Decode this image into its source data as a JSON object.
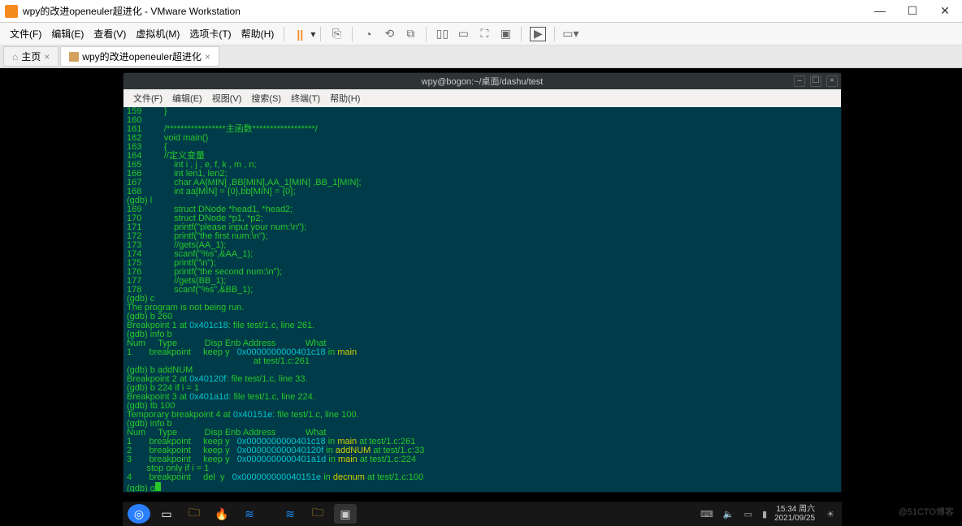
{
  "window": {
    "title": "wpy的改进openeuler超进化 - VMware Workstation"
  },
  "menu": {
    "file": "文件(F)",
    "edit": "编辑(E)",
    "view": "查看(V)",
    "vm": "虚拟机(M)",
    "tabs": "选项卡(T)",
    "help": "帮助(H)"
  },
  "tabs": {
    "home": "主页",
    "vm": "wpy的改进openeuler超进化"
  },
  "guest": {
    "title": "wpy@bogon:~/桌面/dashu/test",
    "menu": {
      "file": "文件(F)",
      "edit": "编辑(E)",
      "view": "视图(V)",
      "search": "搜索(S)",
      "terminal": "终端(T)",
      "help": "帮助(H)"
    }
  },
  "terminal": [
    {
      "lineno": "159",
      "body": "    }"
    },
    {
      "lineno": "160",
      "body": ""
    },
    {
      "lineno": "161",
      "body": "    /*****************主函数******************/"
    },
    {
      "lineno": "162",
      "body": "    void main()"
    },
    {
      "lineno": "163",
      "body": "    {"
    },
    {
      "lineno": "164",
      "body": "    //定义变量"
    },
    {
      "lineno": "165",
      "body": "        int i , j , e, f, k , m , n;"
    },
    {
      "lineno": "166",
      "body": "        int len1, len2;"
    },
    {
      "lineno": "167",
      "body": "        char AA[MIN] ,BB[MIN],AA_1[MIN] ,BB_1[MIN];"
    },
    {
      "lineno": "168",
      "body": "        int aa[MIN] = {0},bb[MIN] = {0};"
    },
    {
      "gdb": "(gdb) l"
    },
    {
      "lineno": "169",
      "body": "        struct DNode *head1, *head2;"
    },
    {
      "lineno": "170",
      "body": "        struct DNode *p1, *p2;"
    },
    {
      "lineno": "171",
      "body": "        printf(\"please input your num:\\n\");"
    },
    {
      "lineno": "172",
      "body": "        printf(\"the first num:\\n\");"
    },
    {
      "lineno": "173",
      "body": "        //gets(AA_1);"
    },
    {
      "lineno": "174",
      "body": "        scanf(\"%s\",&AA_1);"
    },
    {
      "lineno": "175",
      "body": "        printf(\"\\n\");"
    },
    {
      "lineno": "176",
      "body": "        printf(\"the second num:\\n\");"
    },
    {
      "lineno": "177",
      "body": "        //gets(BB_1);"
    },
    {
      "lineno": "178",
      "body": "        scanf(\"%s\",&BB_1);"
    },
    {
      "gdb": "(gdb) c"
    },
    {
      "plain": "The program is not being run."
    },
    {
      "gdb": "(gdb) b 260"
    },
    {
      "bp": "Breakpoint 1 at ",
      "addr": "0x401c18",
      "tail": ": file test/1.c, line 261."
    },
    {
      "gdb": "(gdb) info b"
    },
    {
      "plain": "Num     Type           Disp Enb Address            What"
    },
    {
      "bprow": {
        "num": "1",
        "type": "breakpoint",
        "disp": "keep",
        "enb": "y",
        "addr": "0x0000000000401c18",
        "in": "main"
      }
    },
    {
      "plain": "                                                   at test/1.c:261"
    },
    {
      "gdb": "(gdb) b addNUM"
    },
    {
      "bp": "Breakpoint 2 at ",
      "addr": "0x40120f",
      "tail": ": file test/1.c, line 33."
    },
    {
      "gdb": "(gdb) b 224 if i = 1"
    },
    {
      "bp": "Breakpoint 3 at ",
      "addr": "0x401a1d",
      "tail": ": file test/1.c, line 224."
    },
    {
      "gdb": "(gdb) tb 100"
    },
    {
      "bp": "Temporary breakpoint 4 at ",
      "addr": "0x40151e",
      "tail": ": file test/1.c, line 100."
    },
    {
      "gdb": "(gdb) info b"
    },
    {
      "plain": "Num     Type           Disp Enb Address            What"
    },
    {
      "bprow": {
        "num": "1",
        "type": "breakpoint",
        "disp": "keep",
        "enb": "y",
        "addr": "0x0000000000401c18",
        "in": "main",
        "at": "at test/1.c:261"
      }
    },
    {
      "bprow": {
        "num": "2",
        "type": "breakpoint",
        "disp": "keep",
        "enb": "y",
        "addr": "0x000000000040120f",
        "in": "addNUM",
        "at": "at test/1.c:33"
      }
    },
    {
      "bprow": {
        "num": "3",
        "type": "breakpoint",
        "disp": "keep",
        "enb": "y",
        "addr": "0x0000000000401a1d",
        "in": "main",
        "at": "at test/1.c:224"
      }
    },
    {
      "plain": "        stop only if i = 1"
    },
    {
      "bprow": {
        "num": "4",
        "type": "breakpoint",
        "disp": "del ",
        "enb": "y",
        "addr": "0x000000000040151e",
        "in": "decnum",
        "at": "at test/1.c:100"
      }
    },
    {
      "gdbcursor": "(gdb) g"
    }
  ],
  "taskbar": {
    "time": "15:34 周六",
    "date": "2021/09/25"
  },
  "watermark": "@51CTO博客"
}
